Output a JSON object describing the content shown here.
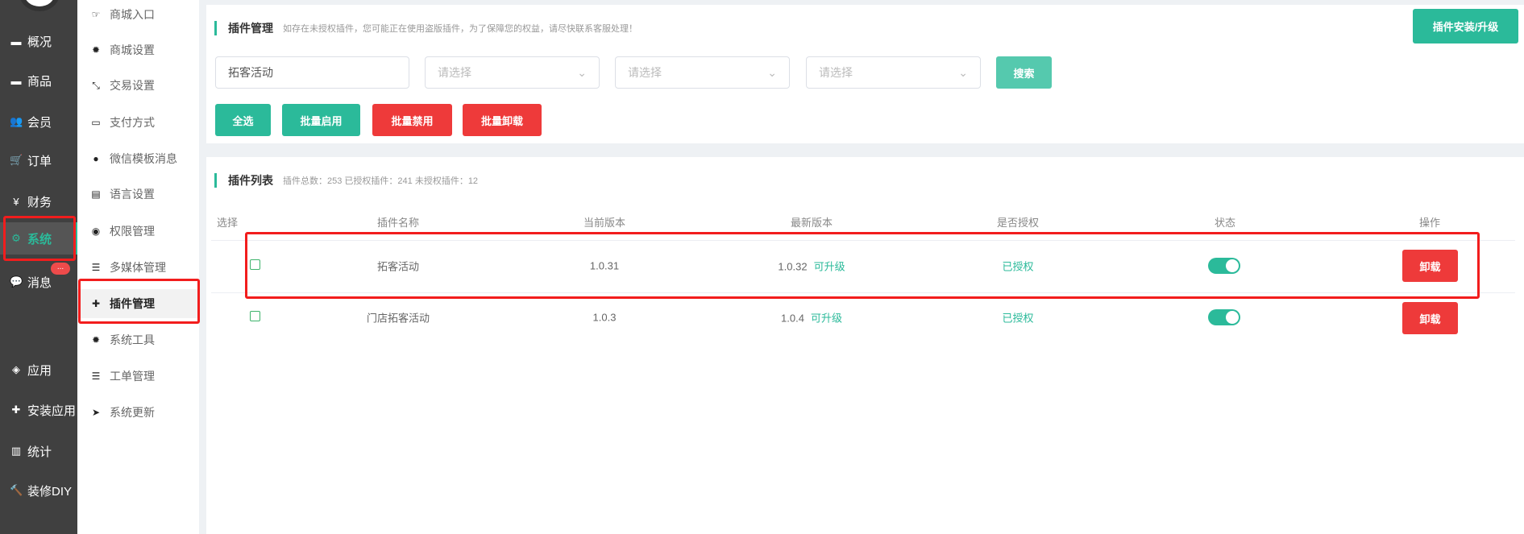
{
  "sidebar": {
    "items": [
      {
        "label": "概况",
        "icon": "archive-icon"
      },
      {
        "label": "商品",
        "icon": "archive-icon"
      },
      {
        "label": "会员",
        "icon": "users-icon"
      },
      {
        "label": "订单",
        "icon": "cart-icon"
      },
      {
        "label": "财务",
        "icon": "yen-icon"
      },
      {
        "label": "系统",
        "icon": "gears-icon"
      },
      {
        "label": "消息",
        "icon": "comment-icon"
      },
      {
        "label": "应用",
        "icon": "cubes-icon"
      },
      {
        "label": "安装应用",
        "icon": "puzzle-icon"
      },
      {
        "label": "统计",
        "icon": "bar-chart-icon"
      },
      {
        "label": "装修DIY",
        "icon": "gavel-icon"
      }
    ],
    "badge": "..."
  },
  "submenu": {
    "items": [
      {
        "label": "商城入口",
        "icon": "hand-right-icon"
      },
      {
        "label": "商城设置",
        "icon": "gear-icon"
      },
      {
        "label": "交易设置",
        "icon": "compress-icon"
      },
      {
        "label": "支付方式",
        "icon": "credit-card-icon"
      },
      {
        "label": "微信模板消息",
        "icon": "wechat-icon"
      },
      {
        "label": "语言设置",
        "icon": "map-icon"
      },
      {
        "label": "权限管理",
        "icon": "gamepad-icon"
      },
      {
        "label": "多媒体管理",
        "icon": "list-icon"
      },
      {
        "label": "插件管理",
        "icon": "puzzle-icon"
      },
      {
        "label": "系统工具",
        "icon": "gear-icon"
      },
      {
        "label": "工单管理",
        "icon": "list-icon"
      },
      {
        "label": "系统更新",
        "icon": "paper-plane-icon"
      }
    ]
  },
  "header": {
    "title": "插件管理",
    "notice": "如存在未授权插件，您可能正在使用盗版插件，为了保障您的权益，请尽快联系客服处理！",
    "install_button": "插件安装/升级"
  },
  "filters": {
    "keyword": "拓客活动",
    "select_placeholder": "请选择",
    "search_button": "搜索"
  },
  "actions": {
    "select_all": "全选",
    "batch_enable": "批量启用",
    "batch_disable": "批量禁用",
    "batch_uninstall": "批量卸载"
  },
  "list": {
    "title": "插件列表",
    "summary": "插件总数：253 已授权插件：241 未授权插件：12",
    "columns": [
      "选择",
      "插件名称",
      "当前版本",
      "最新版本",
      "是否授权",
      "状态",
      "操作"
    ],
    "rows": [
      {
        "name": "拓客活动",
        "current": "1.0.31",
        "latest": "1.0.32",
        "upgrade": "可升级",
        "auth": "已授权",
        "enabled": true,
        "action": "卸载"
      },
      {
        "name": "门店拓客活动",
        "current": "1.0.3",
        "latest": "1.0.4",
        "upgrade": "可升级",
        "auth": "已授权",
        "enabled": true,
        "action": "卸载"
      }
    ]
  },
  "colors": {
    "accent": "#2bba9a",
    "danger": "#ee3a3a",
    "highlight": "#f21d1d"
  }
}
